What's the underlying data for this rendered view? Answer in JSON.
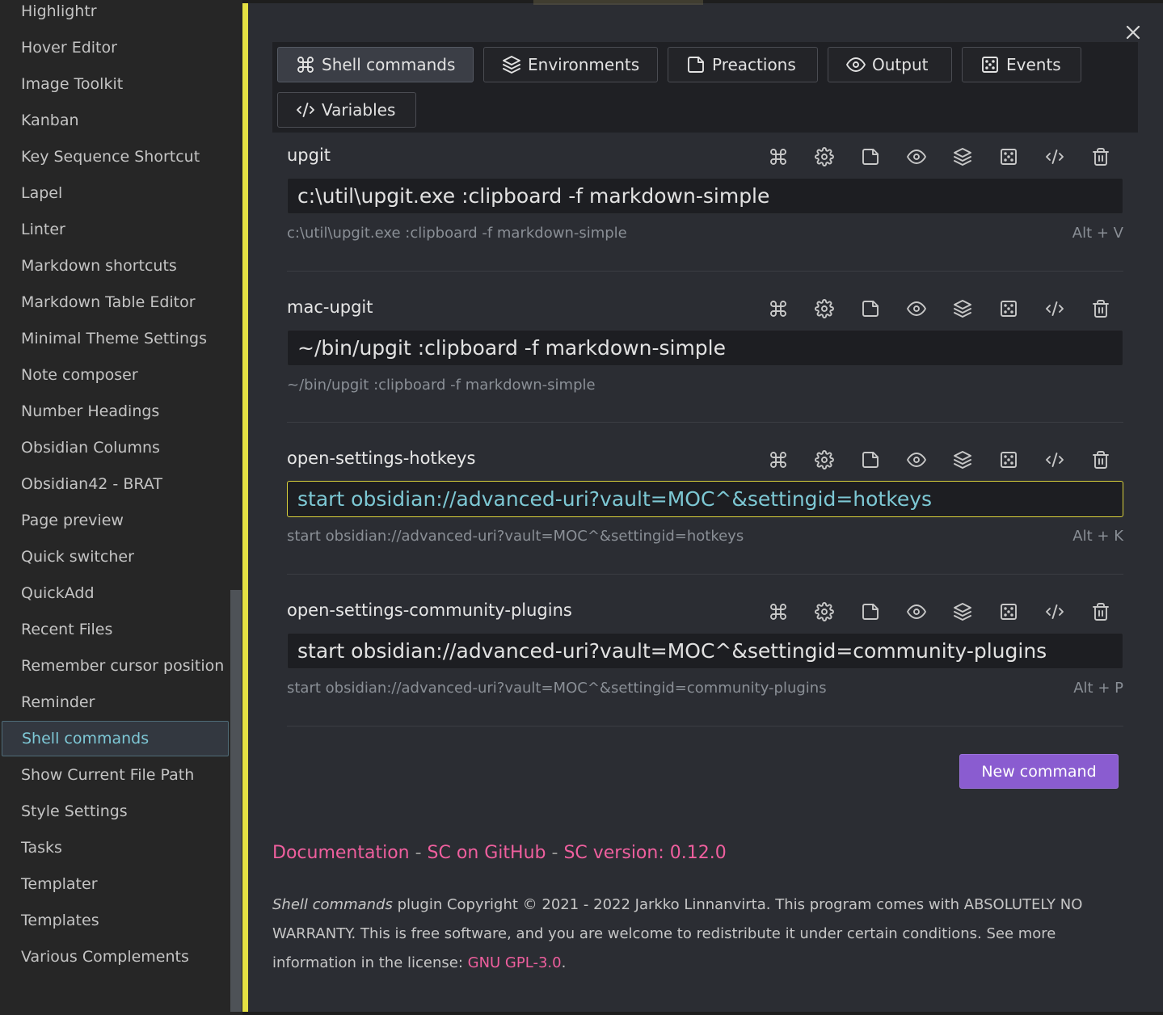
{
  "sidebar": {
    "items": [
      {
        "label": "Highlightr"
      },
      {
        "label": "Hover Editor"
      },
      {
        "label": "Image Toolkit"
      },
      {
        "label": "Kanban"
      },
      {
        "label": "Key Sequence Shortcut"
      },
      {
        "label": "Lapel"
      },
      {
        "label": "Linter"
      },
      {
        "label": "Markdown shortcuts"
      },
      {
        "label": "Markdown Table Editor"
      },
      {
        "label": "Minimal Theme Settings"
      },
      {
        "label": "Note composer"
      },
      {
        "label": "Number Headings"
      },
      {
        "label": "Obsidian Columns"
      },
      {
        "label": "Obsidian42 - BRAT"
      },
      {
        "label": "Page preview"
      },
      {
        "label": "Quick switcher"
      },
      {
        "label": "QuickAdd"
      },
      {
        "label": "Recent Files"
      },
      {
        "label": "Remember cursor position"
      },
      {
        "label": "Reminder"
      },
      {
        "label": "Shell commands",
        "active": true
      },
      {
        "label": "Show Current File Path"
      },
      {
        "label": "Style Settings"
      },
      {
        "label": "Tasks"
      },
      {
        "label": "Templater"
      },
      {
        "label": "Templates"
      },
      {
        "label": "Various Complements"
      }
    ]
  },
  "modal": {
    "close_label": "×",
    "tabs": [
      {
        "label": "Shell commands",
        "icon": "command-icon"
      },
      {
        "label": "Environments",
        "icon": "layers-icon"
      },
      {
        "label": "Preactions",
        "icon": "sticky-note-icon"
      },
      {
        "label": "Output",
        "icon": "eye-icon"
      },
      {
        "label": "Events",
        "icon": "dice-icon"
      },
      {
        "label": "Variables",
        "icon": "code-icon"
      }
    ],
    "command_icons": [
      "command-icon",
      "gear-icon",
      "sticky-note-icon",
      "eye-icon",
      "layers-icon",
      "dice-icon",
      "code-icon",
      "trash-icon"
    ],
    "commands": [
      {
        "name": "upgit",
        "value": "c:\\util\\upgit.exe :clipboard -f markdown-simple",
        "preview": "c:\\util\\upgit.exe :clipboard -f markdown-simple",
        "hotkey": "Alt + V"
      },
      {
        "name": "mac-upgit",
        "value": "~/bin/upgit :clipboard -f markdown-simple",
        "preview": "~/bin/upgit :clipboard -f markdown-simple",
        "hotkey": ""
      },
      {
        "name": "open-settings-hotkeys",
        "value": "start obsidian://advanced-uri?vault=MOC^&settingid=hotkeys",
        "preview": "start obsidian://advanced-uri?vault=MOC^&settingid=hotkeys",
        "hotkey": "Alt + K",
        "focused": true
      },
      {
        "name": "open-settings-community-plugins",
        "value": "start obsidian://advanced-uri?vault=MOC^&settingid=community-plugins",
        "preview": "start obsidian://advanced-uri?vault=MOC^&settingid=community-plugins",
        "hotkey": "Alt + P"
      }
    ],
    "new_command_label": "New command",
    "footer": {
      "documentation_label": "Documentation",
      "separator": " - ",
      "github_label": "SC on GitHub",
      "version_label": "SC version: 0.12.0",
      "copyright_plugin_name": "Shell commands",
      "copyright_text": " plugin Copyright © 2021 - 2022 Jarkko Linnanvirta. This program comes with ABSOLUTELY NO WARRANTY. This is free software, and you are welcome to redistribute it under certain conditions. See more information in the license: ",
      "license_label": "GNU GPL-3.0",
      "copyright_end": "."
    }
  },
  "colors": {
    "accent_purple": "#8a5cd0",
    "link_pink": "#ef5f9e",
    "focus_yellow": "#d9d13c",
    "active_cyan": "#7ec8d6"
  }
}
